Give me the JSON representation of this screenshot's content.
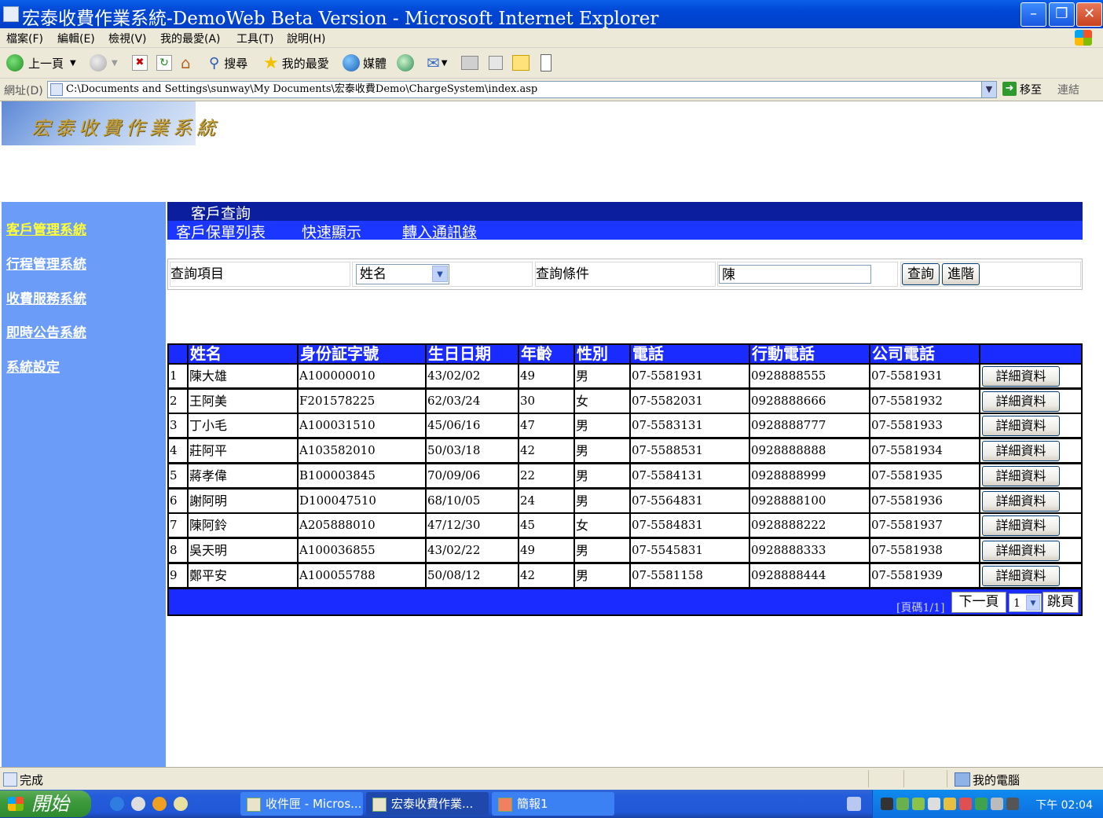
{
  "window": {
    "title": "宏泰收費作業系統-DemoWeb Beta Version - Microsoft Internet Explorer",
    "min_icon": "minimize-icon",
    "max_icon": "maximize-icon",
    "close_icon": "close-icon"
  },
  "menu": {
    "file": "檔案(F)",
    "edit": "編輯(E)",
    "view": "檢視(V)",
    "favorites": "我的最愛(A)",
    "tools": "工具(T)",
    "help": "說明(H)"
  },
  "toolbar": {
    "back": "上一頁",
    "search": "搜尋",
    "favorites": "我的最愛",
    "media": "媒體"
  },
  "address": {
    "label": "網址(D)",
    "url": "C:\\Documents and Settings\\sunway\\My Documents\\宏泰收費Demo\\ChargeSystem\\index.asp",
    "go": "移至",
    "links": "連結"
  },
  "logo": {
    "text": "宏泰收費作業系統"
  },
  "sidebar": {
    "items": [
      {
        "label": "客戶管理系統",
        "active": true
      },
      {
        "label": "行程管理系統",
        "active": false
      },
      {
        "label": "收費服務系統",
        "active": false
      },
      {
        "label": "即時公告系統",
        "active": false
      },
      {
        "label": "系統設定",
        "active": false
      }
    ]
  },
  "section": {
    "title": "客戶查詢",
    "tabs": [
      "客戶保單列表",
      "快速顯示",
      "轉入通訊錄"
    ]
  },
  "query": {
    "item_label": "查詢項目",
    "item_value": "姓名",
    "cond_label": "查詢條件",
    "cond_value": "陳",
    "search_btn": "查詢",
    "advanced_btn": "進階"
  },
  "table": {
    "columns": [
      "",
      "姓名",
      "身份証字號",
      "生日日期",
      "年齡",
      "性別",
      "電話",
      "行動電話",
      "公司電話",
      ""
    ],
    "detail_label": "詳細資料",
    "rows": [
      [
        "1",
        "陳大雄",
        "A100000010",
        "43/02/02",
        "49",
        "男",
        "07-5581931",
        "0928888555",
        "07-5581931"
      ],
      [
        "2",
        "王阿美",
        "F201578225",
        "62/03/24",
        "30",
        "女",
        "07-5582031",
        "0928888666",
        "07-5581932"
      ],
      [
        "3",
        "丁小毛",
        "A100031510",
        "45/06/16",
        "47",
        "男",
        "07-5583131",
        "0928888777",
        "07-5581933"
      ],
      [
        "4",
        "莊阿平",
        "A103582010",
        "50/03/18",
        "42",
        "男",
        "07-5588531",
        "0928888888",
        "07-5581934"
      ],
      [
        "5",
        "蔣孝偉",
        "B100003845",
        "70/09/06",
        "22",
        "男",
        "07-5584131",
        "0928888999",
        "07-5581935"
      ],
      [
        "6",
        "謝阿明",
        "D100047510",
        "68/10/05",
        "24",
        "男",
        "07-5564831",
        "0928888100",
        "07-5581936"
      ],
      [
        "7",
        "陳阿鈴",
        "A205888010",
        "47/12/30",
        "45",
        "女",
        "07-5584831",
        "0928888222",
        "07-5581937"
      ],
      [
        "8",
        "吳天明",
        "A100036855",
        "43/02/22",
        "49",
        "男",
        "07-5545831",
        "0928888333",
        "07-5581938"
      ],
      [
        "9",
        "鄭平安",
        "A100055788",
        "50/08/12",
        "42",
        "男",
        "07-5581158",
        "0928888444",
        "07-5581939"
      ]
    ]
  },
  "pager": {
    "info": "[頁碼1/1]",
    "next": "下一頁",
    "page": "1",
    "jump": "跳頁"
  },
  "status": {
    "text": "完成",
    "zone": "我的電腦"
  },
  "taskbar": {
    "start": "開始",
    "tasks": [
      {
        "label": "收件匣 - Micros...",
        "active": false
      },
      {
        "label": "宏泰收費作業...",
        "active": true
      },
      {
        "label": "簡報1",
        "active": false
      }
    ],
    "clock": "下午 02:04"
  },
  "colors": {
    "sidebar_bg": "#6b9cf7",
    "nav_active": "#ffff33",
    "header_dark": "#0b1e9e",
    "header_blue": "#1a36ff",
    "grid_header": "#1a2bff"
  }
}
